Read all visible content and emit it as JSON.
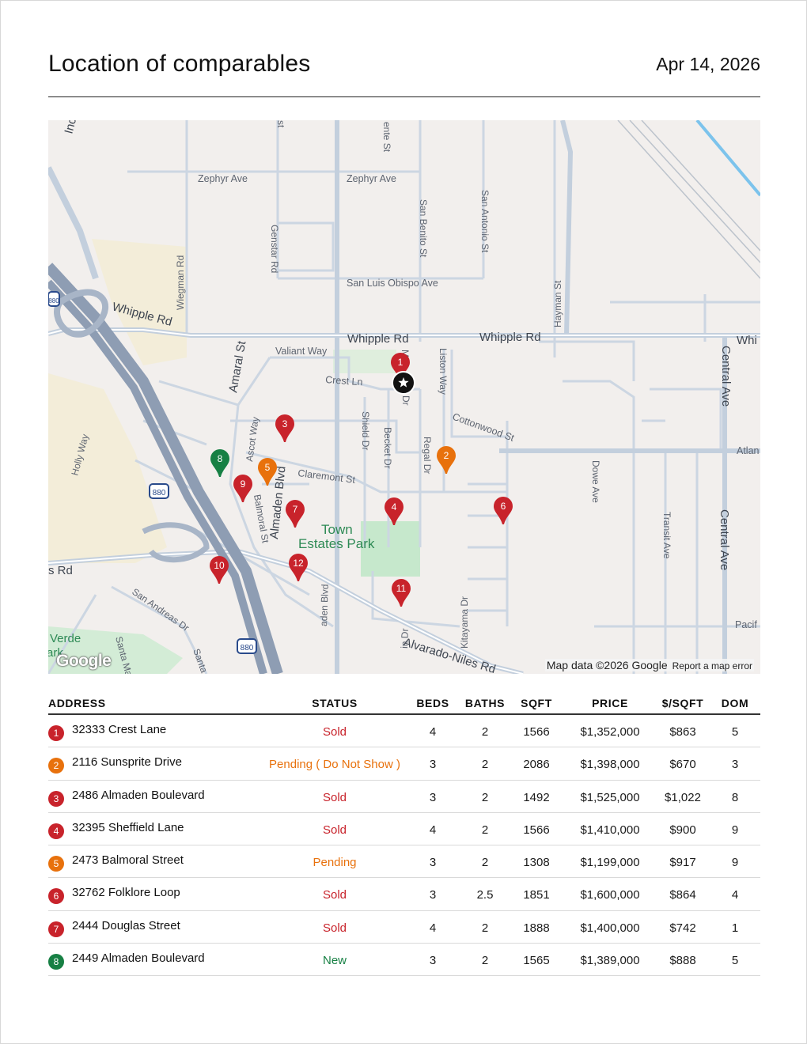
{
  "header": {
    "title": "Location of comparables",
    "date": "Apr 14, 2026"
  },
  "colors": {
    "sold": "#c8232b",
    "pending": "#e8710c",
    "new": "#178044",
    "subject": "#111111"
  },
  "map": {
    "streets": [
      "Zephyr Ave",
      "Zephyr Ave",
      "San Luis Obispo Ave",
      "Whipple Rd",
      "Whipple Rd",
      "Whipple Rd",
      "Whi",
      "Valiant Way",
      "Crest Ln",
      "Claremont St",
      "Cottonwood St",
      "Amaral St",
      "Ascot Way",
      "Balmoral St",
      "Almaden Blvd",
      "Shield Dr",
      "Becket Dr",
      "Regal Dr",
      "Liston Way",
      "San Benito St",
      "San Antonio St",
      "Genstar Rd",
      "Wiegman Rd",
      "Hayman St",
      "Dowe Ave",
      "Transit Ave",
      "Central Ave",
      "Central Ave",
      "Atlan",
      "Pacif",
      "Holly Way",
      "Alvarado-Niles Rd",
      "San Andreas Dr",
      "Kitayama Dr",
      "Santa",
      "Santa Ma",
      "Verde",
      "ark",
      "s Rd",
      "Inc",
      "ente St",
      "Ma",
      "Dr",
      "aden Blvd",
      "in Dr",
      "st"
    ],
    "park": "Town Estates Park",
    "highway_shields": [
      "880",
      "880",
      "880"
    ],
    "markers": [
      "1",
      "2",
      "3",
      "4",
      "5",
      "6",
      "7",
      "8",
      "9",
      "10",
      "11",
      "12"
    ],
    "subject_icon": "star-icon",
    "logo": "Google",
    "attribution": "Map data ©2026 Google",
    "report": "Report a map error"
  },
  "table": {
    "headers": [
      "ADDRESS",
      "STATUS",
      "BEDS",
      "BATHS",
      "SQFT",
      "PRICE",
      "$/SQFT",
      "DOM"
    ],
    "rows": [
      {
        "num": "1",
        "address": "32333 Crest Lane",
        "status": "Sold",
        "beds": "4",
        "baths": "2",
        "sqft": "1566",
        "price": "$1,352,000",
        "ppsf": "$863",
        "dom": "5",
        "color": "#c8232b"
      },
      {
        "num": "2",
        "address": "2116 Sunsprite Drive",
        "status": "Pending ( Do Not Show )",
        "beds": "3",
        "baths": "2",
        "sqft": "2086",
        "price": "$1,398,000",
        "ppsf": "$670",
        "dom": "3",
        "color": "#e8710c"
      },
      {
        "num": "3",
        "address": "2486 Almaden Boulevard",
        "status": "Sold",
        "beds": "3",
        "baths": "2",
        "sqft": "1492",
        "price": "$1,525,000",
        "ppsf": "$1,022",
        "dom": "8",
        "color": "#c8232b"
      },
      {
        "num": "4",
        "address": "32395 Sheffield Lane",
        "status": "Sold",
        "beds": "4",
        "baths": "2",
        "sqft": "1566",
        "price": "$1,410,000",
        "ppsf": "$900",
        "dom": "9",
        "color": "#c8232b"
      },
      {
        "num": "5",
        "address": "2473 Balmoral Street",
        "status": "Pending",
        "beds": "3",
        "baths": "2",
        "sqft": "1308",
        "price": "$1,199,000",
        "ppsf": "$917",
        "dom": "9",
        "color": "#e8710c"
      },
      {
        "num": "6",
        "address": "32762 Folklore Loop",
        "status": "Sold",
        "beds": "3",
        "baths": "2.5",
        "sqft": "1851",
        "price": "$1,600,000",
        "ppsf": "$864",
        "dom": "4",
        "color": "#c8232b"
      },
      {
        "num": "7",
        "address": "2444 Douglas Street",
        "status": "Sold",
        "beds": "4",
        "baths": "2",
        "sqft": "1888",
        "price": "$1,400,000",
        "ppsf": "$742",
        "dom": "1",
        "color": "#c8232b"
      },
      {
        "num": "8",
        "address": "2449 Almaden Boulevard",
        "status": "New",
        "beds": "3",
        "baths": "2",
        "sqft": "1565",
        "price": "$1,389,000",
        "ppsf": "$888",
        "dom": "5",
        "color": "#178044"
      }
    ]
  }
}
